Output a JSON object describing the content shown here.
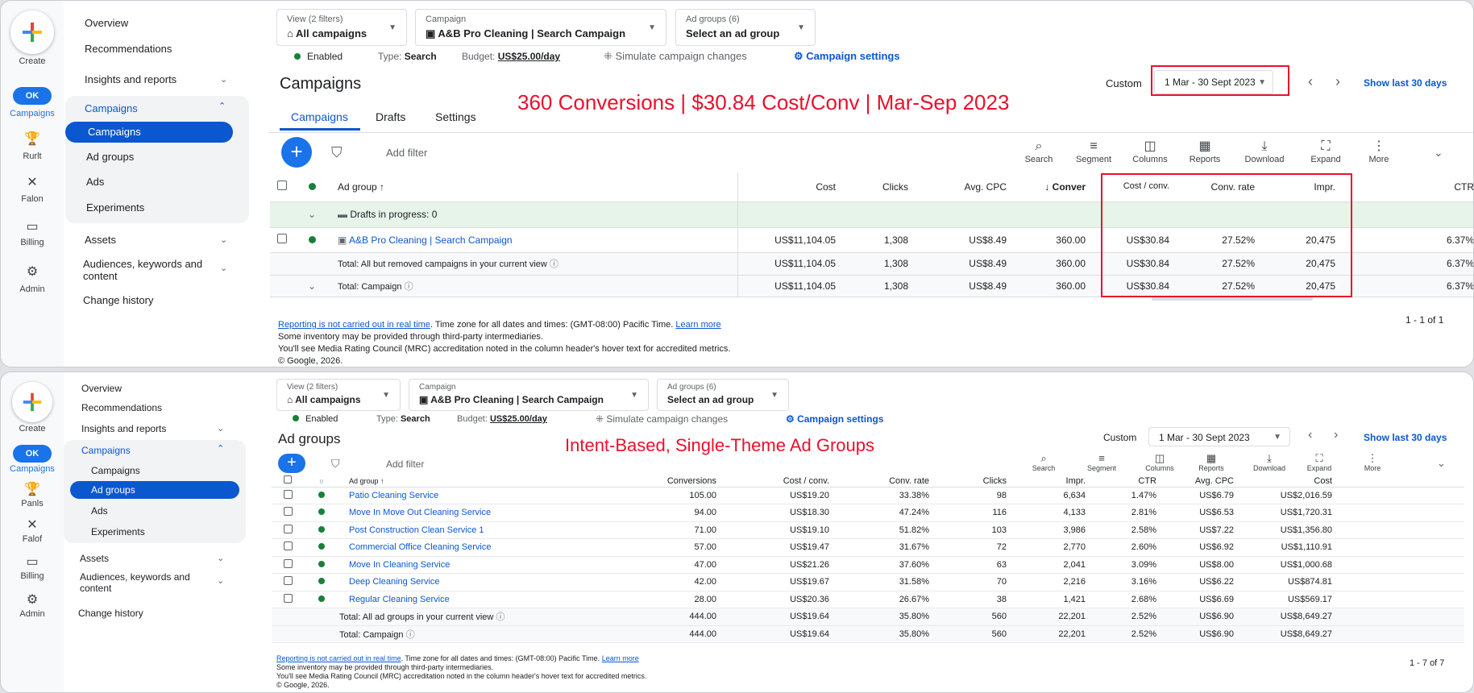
{
  "rail": {
    "create": "Create",
    "campaigns": "Campaigns",
    "campaigns_badge": "OK",
    "goals": "Rurlt",
    "tools": "Falon",
    "billing": "Billing",
    "admin": "Admin"
  },
  "rail2": {
    "create": "Create",
    "campaigns": "Campaigns",
    "campaigns_badge": "OK",
    "goals": "Panls",
    "tools": "Falof",
    "billing": "Billing",
    "admin": "Admin"
  },
  "nav": {
    "overview": "Overview",
    "recommendations": "Recommendations",
    "insights": "Insights and reports",
    "campaigns_group": "Campaigns",
    "campaigns": "Campaigns",
    "ad_groups": "Ad groups",
    "ads": "Ads",
    "experiments": "Experiments",
    "assets": "Assets",
    "audiences": "Audiences, keywords and content",
    "change_history": "Change history"
  },
  "filters": {
    "view_label": "View (2 filters)",
    "view_value": "All campaigns",
    "campaign_label": "Campaign",
    "campaign_value": "A&B Pro Cleaning | Search Campaign",
    "adgroups_label": "Ad groups (6)",
    "adgroups_value": "Select an ad group"
  },
  "status": {
    "enabled": "Enabled",
    "type_label": "Type:",
    "type_value": "Search",
    "budget_label": "Budget:",
    "budget_value": "US$25.00/day",
    "simulate": "Simulate campaign changes",
    "settings": "Campaign settings"
  },
  "date": {
    "custom": "Custom",
    "range": "1 Mar - 30 Sept 2023",
    "show_last": "Show last 30 days"
  },
  "top": {
    "title": "Campaigns",
    "annotation": "360 Conversions | $30.84 Cost/Conv | Mar-Sep 2023",
    "tabs": [
      "Campaigns",
      "Drafts",
      "Settings"
    ],
    "add_filter": "Add filter",
    "tools": [
      "Search",
      "Segment",
      "Columns",
      "Reports",
      "Download",
      "Expand",
      "More"
    ],
    "headers": {
      "name": "Ad group",
      "cost": "Cost",
      "clicks": "Clicks",
      "cpc": "Avg. CPC",
      "conv": "Conver",
      "cpa": "Cost / conv.",
      "rate": "Conv. rate",
      "impr": "Impr.",
      "ctr": "CTR"
    },
    "drafts": "Drafts in progress: 0",
    "rows": [
      {
        "name": "A&B Pro Cleaning | Search Campaign",
        "cost": "US$11,104.05",
        "clicks": "1,308",
        "cpc": "US$8.49",
        "conv": "360.00",
        "cpa": "US$30.84",
        "rate": "27.52%",
        "impr": "20,475",
        "ctr": "6.37%"
      },
      {
        "name": "Total: All but removed campaigns in your current view",
        "cost": "US$11,104.05",
        "clicks": "1,308",
        "cpc": "US$8.49",
        "conv": "360.00",
        "cpa": "US$30.84",
        "rate": "27.52%",
        "impr": "20,475",
        "ctr": "6.37%"
      },
      {
        "name": "Total: Campaign",
        "cost": "US$11,104.05",
        "clicks": "1,308",
        "cpc": "US$8.49",
        "conv": "360.00",
        "cpa": "US$30.84",
        "rate": "27.52%",
        "impr": "20,475",
        "ctr": "6.37%"
      }
    ],
    "pagination": "1 - 1 of 1"
  },
  "bottom": {
    "title": "Ad groups",
    "annotation": "Intent-Based, Single-Theme Ad Groups",
    "add_filter": "Add filter",
    "tools": [
      "Search",
      "Segment",
      "Columns",
      "Reports",
      "Download",
      "Expand",
      "More"
    ],
    "headers": {
      "name": "Ad group",
      "conv": "Conversions",
      "cpa": "Cost / conv.",
      "rate": "Conv. rate",
      "clicks": "Clicks",
      "impr": "Impr.",
      "ctr": "CTR",
      "cpc": "Avg. CPC",
      "cost": "Cost"
    },
    "rows": [
      {
        "name": "Patio Cleaning Service",
        "conv": "105.00",
        "cpa": "US$19.20",
        "rate": "33.38%",
        "clicks": "98",
        "impr": "6,634",
        "ctr": "1.47%",
        "cpc": "US$6.79",
        "cost": "US$2,016.59"
      },
      {
        "name": "Move In Move Out Cleaning Service",
        "conv": "94.00",
        "cpa": "US$18.30",
        "rate": "47.24%",
        "clicks": "116",
        "impr": "4,133",
        "ctr": "2.81%",
        "cpc": "US$6.53",
        "cost": "US$1,720.31"
      },
      {
        "name": "Post Construction Clean Service 1",
        "conv": "71.00",
        "cpa": "US$19.10",
        "rate": "51.82%",
        "clicks": "103",
        "impr": "3,986",
        "ctr": "2.58%",
        "cpc": "US$7.22",
        "cost": "US$1,356.80"
      },
      {
        "name": "Commercial Office Cleaning Service",
        "conv": "57.00",
        "cpa": "US$19.47",
        "rate": "31.67%",
        "clicks": "72",
        "impr": "2,770",
        "ctr": "2.60%",
        "cpc": "US$6.92",
        "cost": "US$1,110.91"
      },
      {
        "name": "Move In Cleaning Service",
        "conv": "47.00",
        "cpa": "US$21.26",
        "rate": "37.60%",
        "clicks": "63",
        "impr": "2,041",
        "ctr": "3.09%",
        "cpc": "US$8.00",
        "cost": "US$1,000.68"
      },
      {
        "name": "Deep Cleaning Service",
        "conv": "42.00",
        "cpa": "US$19.67",
        "rate": "31.58%",
        "clicks": "70",
        "impr": "2,216",
        "ctr": "3.16%",
        "cpc": "US$6.22",
        "cost": "US$874.81"
      },
      {
        "name": "Regular Cleaning Service",
        "conv": "28.00",
        "cpa": "US$20.36",
        "rate": "26.67%",
        "clicks": "38",
        "impr": "1,421",
        "ctr": "2.68%",
        "cpc": "US$6.69",
        "cost": "US$569.17"
      }
    ],
    "totals": [
      {
        "name": "Total: All ad groups in your current view",
        "conv": "444.00",
        "cpa": "US$19.64",
        "rate": "35.80%",
        "clicks": "560",
        "impr": "22,201",
        "ctr": "2.52%",
        "cpc": "US$6.90",
        "cost": "US$8,649.27"
      },
      {
        "name": "Total: Campaign",
        "conv": "444.00",
        "cpa": "US$19.64",
        "rate": "35.80%",
        "clicks": "560",
        "impr": "22,201",
        "ctr": "2.52%",
        "cpc": "US$6.90",
        "cost": "US$8,649.27"
      }
    ],
    "pagination": "1 - 7 of 7"
  },
  "footer": {
    "link": "Reporting is not carried out in real time",
    "line1": ". Time zone for all dates and times: (GMT-08:00) Pacific Time.",
    "learn": "Learn more",
    "line2": "Some inventory may be provided through third-party intermediaries.",
    "line3": "You'll see Media Rating Council (MRC) accreditation noted in the column header's hover text for accredited metrics.",
    "line4": "© Google, 2026."
  },
  "colors": {
    "accent": "#1a73e8",
    "annotation": "#e8112b",
    "enabled": "#188038"
  }
}
